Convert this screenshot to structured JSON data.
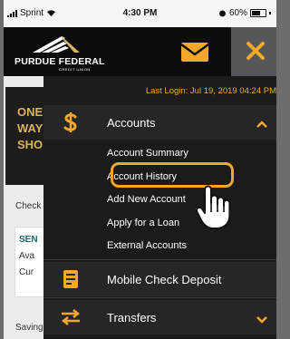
{
  "status_bar": {
    "carrier": "Sprint",
    "time": "4:30 PM",
    "battery": "60%"
  },
  "header": {
    "logo_name": "PURDUE FEDERAL",
    "logo_sub": "CREDIT UNION",
    "mail_icon": "envelope-icon",
    "close_icon": "close-icon"
  },
  "background": {
    "promo_lines": [
      "ONE",
      "WAY",
      "SHO"
    ],
    "check_label": "Check",
    "card_lines": [
      "SEN",
      "Ava",
      "Cur"
    ],
    "savings_label": "Saving"
  },
  "menu": {
    "last_login": "Last Login: Jul 19, 2019 04:24 PM",
    "accounts": {
      "label": "Accounts",
      "icon": "dollar-icon",
      "items": [
        "Account Summary",
        "Account History",
        "Add New Account",
        "Apply for a Loan",
        "External Accounts"
      ]
    },
    "mobile_check_deposit": {
      "label": "Mobile Check Deposit",
      "icon": "check-deposit-icon"
    },
    "transfers": {
      "label": "Transfers",
      "icon": "transfer-arrows-icon"
    }
  },
  "colors": {
    "accent": "#f2a928",
    "menu_bg": "#1b1b1b",
    "header_bg": "#0c0c0c",
    "close_bg": "#55575a"
  }
}
